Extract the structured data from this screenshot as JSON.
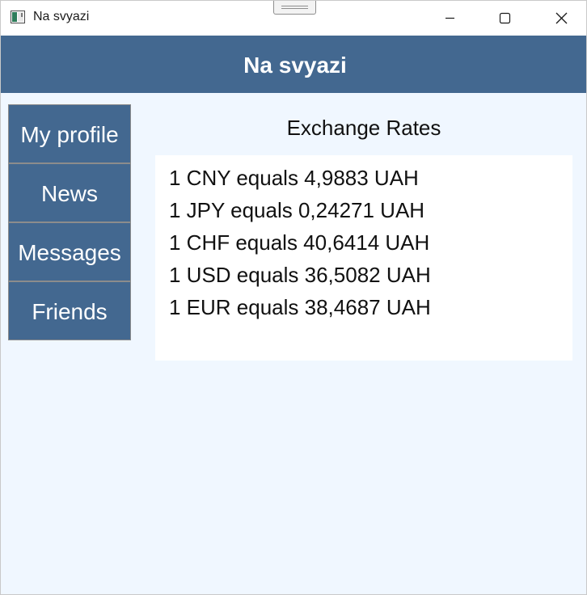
{
  "window": {
    "title": "Na svyazi"
  },
  "header": {
    "title": "Na svyazi",
    "color": "#436890"
  },
  "sidebar": {
    "items": [
      {
        "label": "My profile"
      },
      {
        "label": "News"
      },
      {
        "label": "Messages"
      },
      {
        "label": "Friends"
      }
    ]
  },
  "main": {
    "title": "Exchange Rates",
    "rates": [
      "1 CNY equals 4,9883 UAH",
      "1 JPY equals 0,24271 UAH",
      "1 CHF equals 40,6414 UAH",
      "1 USD equals 36,5082 UAH",
      "1 EUR equals 38,4687 UAH"
    ]
  },
  "icons": {
    "app": "app-window-icon",
    "minimize": "minimize-icon",
    "maximize": "maximize-icon",
    "close": "close-icon"
  }
}
